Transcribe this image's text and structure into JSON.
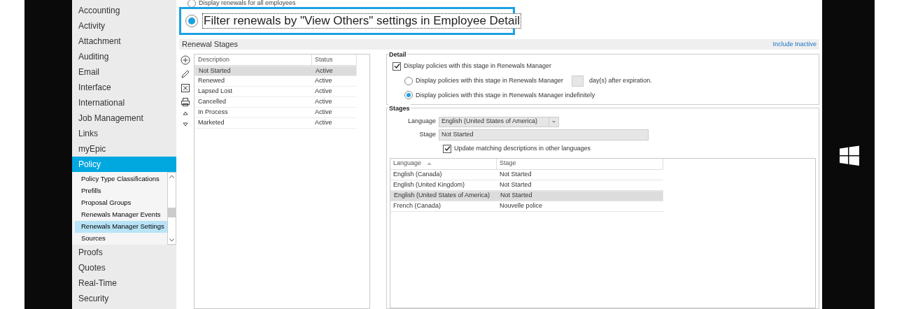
{
  "sidebar": {
    "items": [
      {
        "label": "Accounting",
        "selected": false
      },
      {
        "label": "Activity",
        "selected": false
      },
      {
        "label": "Attachment",
        "selected": false
      },
      {
        "label": "Auditing",
        "selected": false
      },
      {
        "label": "Email",
        "selected": false
      },
      {
        "label": "Interface",
        "selected": false
      },
      {
        "label": "International",
        "selected": false
      },
      {
        "label": "Job Management",
        "selected": false
      },
      {
        "label": "Links",
        "selected": false
      },
      {
        "label": "myEpic",
        "selected": false
      },
      {
        "label": "Policy",
        "selected": true,
        "children": [
          {
            "label": "Policy Type Classifications",
            "selected": false
          },
          {
            "label": "Prefills",
            "selected": false
          },
          {
            "label": "Proposal Groups",
            "selected": false
          },
          {
            "label": "Renewals Manager Events",
            "selected": false
          },
          {
            "label": "Renewals Manager Settings",
            "selected": true
          },
          {
            "label": "Sources",
            "selected": false
          }
        ]
      },
      {
        "label": "Proofs",
        "selected": false
      },
      {
        "label": "Quotes",
        "selected": false
      },
      {
        "label": "Real-Time",
        "selected": false
      },
      {
        "label": "Security",
        "selected": false
      }
    ]
  },
  "filter_options": [
    {
      "label": "Display renewals for all employees",
      "selected": false,
      "highlighted": false
    },
    {
      "label": "Filter renewals by \"View Others\" settings in Employee Detail",
      "selected": true,
      "highlighted": true
    }
  ],
  "renewal_stages": {
    "title": "Renewal Stages",
    "link": "Include Inactive",
    "columns": [
      "Description",
      "Status"
    ],
    "rows": [
      {
        "description": "Not Started",
        "status": "Active",
        "selected": true
      },
      {
        "description": "Renewed",
        "status": "Active",
        "selected": false
      },
      {
        "description": "Lapsed Lost",
        "status": "Active",
        "selected": false
      },
      {
        "description": "Cancelled",
        "status": "Active",
        "selected": false
      },
      {
        "description": "In Process",
        "status": "Active",
        "selected": false
      },
      {
        "description": "Marketed",
        "status": "Active",
        "selected": false
      }
    ]
  },
  "detail": {
    "title": "Detail",
    "display_checkbox": {
      "label": "Display policies with this stage in Renewals Manager",
      "checked": true
    },
    "options": [
      {
        "label": "Display policies with this stage in Renewals Manager",
        "suffix": "day(s) after expiration.",
        "selected": false
      },
      {
        "label": "Display policies with this stage in Renewals Manager indefinitely",
        "selected": true
      }
    ]
  },
  "stages": {
    "title": "Stages",
    "language_label": "Language",
    "language_value": "English (United States of America)",
    "stage_label": "Stage",
    "stage_value": "Not Started",
    "update_checkbox": {
      "label": "Update matching descriptions in other languages",
      "checked": true
    },
    "columns": [
      "Language",
      "Stage"
    ],
    "rows": [
      {
        "language": "English (Canada)",
        "stage": "Not Started",
        "selected": false
      },
      {
        "language": "English (United Kingdom)",
        "stage": "Not Started",
        "selected": false
      },
      {
        "language": "English (United States of America)",
        "stage": "Not Started",
        "selected": true
      },
      {
        "language": "French (Canada)",
        "stage": "Nouvelle police",
        "selected": false
      }
    ]
  }
}
